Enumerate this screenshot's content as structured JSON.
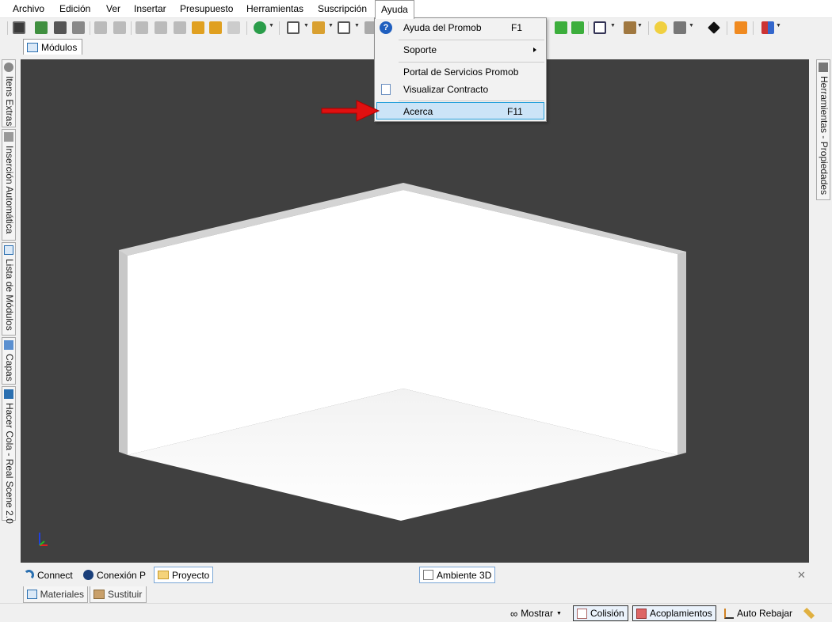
{
  "menubar": {
    "items": [
      "Archivo",
      "Edición",
      "Ver",
      "Insertar",
      "Presupuesto",
      "Herramientas",
      "Suscripción",
      "Ayuda"
    ]
  },
  "module_tab": {
    "label": "Módulos"
  },
  "left_dock": {
    "tabs": [
      "Itens Extras",
      "Inserción Automática",
      "Lista de Módulos",
      "Capas",
      "Hacer Cola - Real Scene 2.0"
    ]
  },
  "right_dock": {
    "tab": "Herramientas - Propiedades"
  },
  "help_menu": {
    "items": [
      {
        "label": "Ayuda del Promob",
        "shortcut": "F1"
      },
      {
        "label": "Soporte",
        "shortcut": ""
      },
      {
        "label": "Portal de Servicios Promob",
        "shortcut": ""
      },
      {
        "label": "Visualizar Contracto",
        "shortcut": ""
      },
      {
        "label": "Acerca",
        "shortcut": "F11"
      }
    ]
  },
  "bottom_tabs": {
    "connect": "Connect",
    "conexion": "Conexión P",
    "proyecto": "Proyecto",
    "ambiente": "Ambiente 3D"
  },
  "lower_tabs": {
    "materiales": "Materiales",
    "sustituir": "Sustituir"
  },
  "status_bar": {
    "mostrar": "Mostrar",
    "colision": "Colisión",
    "acoplamientos": "Acoplamientos",
    "auto_rebajar": "Auto Rebajar"
  },
  "colors": {
    "viewport_bg": "#404040",
    "highlight": "#cce4f7",
    "arrow": "#e01010"
  }
}
